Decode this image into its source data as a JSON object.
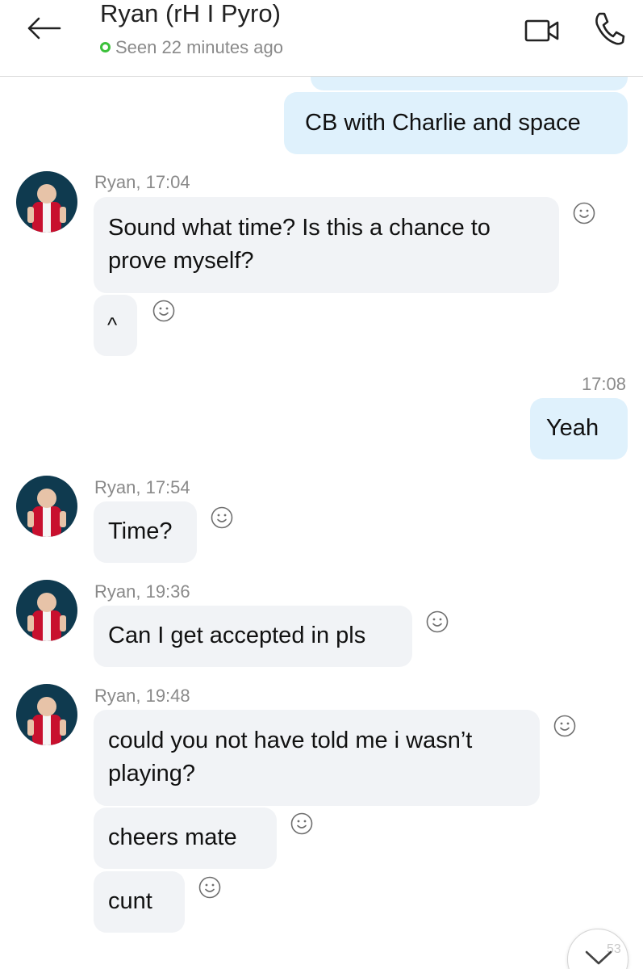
{
  "header": {
    "title": "Ryan (rH I Pyro)",
    "status": "Seen 22 minutes ago",
    "back_icon": "arrow-left-icon",
    "video_icon": "video-camera-icon",
    "call_icon": "phone-icon"
  },
  "messages": {
    "m1": {
      "text": "CB with Charlie and space"
    },
    "g1": {
      "sender": "Ryan, 17:04",
      "line1": "Sound what time? Is this a chance to",
      "line2": "prove myself?",
      "caret": "^"
    },
    "m2": {
      "time": "17:08",
      "text": "Yeah"
    },
    "g2": {
      "sender": "Ryan, 17:54",
      "text": "Time?"
    },
    "g3": {
      "sender": "Ryan, 19:36",
      "text": "Can I get accepted in pls"
    },
    "g4": {
      "sender": "Ryan, 19:48",
      "line1": "could you not have told me i wasn’t",
      "line2": "playing?",
      "text2": "cheers mate",
      "text3": "cunt"
    }
  },
  "scroll": {
    "icon": "chevron-down-icon",
    "count": "53"
  },
  "colors": {
    "outgoing_bubble": "#dff1fc",
    "incoming_bubble": "#f1f3f6",
    "online": "#3cc13b",
    "avatar_bg": "#0f3a4f"
  }
}
